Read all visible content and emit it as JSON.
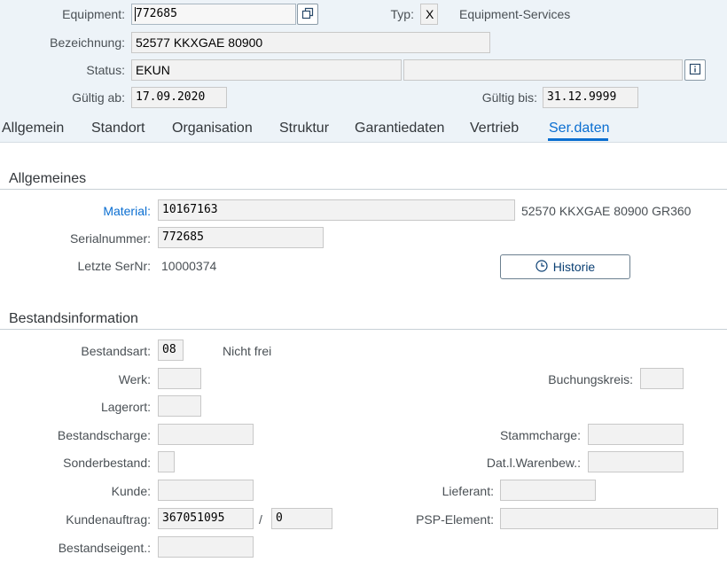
{
  "header": {
    "equipment_label": "Equipment:",
    "equipment_value": "772685",
    "typ_label": "Typ:",
    "typ_value": "X",
    "typ_text": "Equipment-Services",
    "bezeichnung_label": "Bezeichnung:",
    "bezeichnung_value": "52577 KKXGAE 80900",
    "status_label": "Status:",
    "status_value": "EKUN",
    "status_value2": "",
    "gueltig_ab_label": "Gültig ab:",
    "gueltig_ab_value": "17.09.2020",
    "gueltig_bis_label": "Gültig bis:",
    "gueltig_bis_value": "31.12.9999",
    "icons": {
      "equipment_button": "copy-window-icon",
      "status_button": "info-icon"
    }
  },
  "tabs": [
    {
      "label": "Allgemein"
    },
    {
      "label": "Standort"
    },
    {
      "label": "Organisation"
    },
    {
      "label": "Struktur"
    },
    {
      "label": "Garantiedaten"
    },
    {
      "label": "Vertrieb"
    },
    {
      "label": "Ser.daten"
    }
  ],
  "active_tab": "Ser.daten",
  "allgemeines": {
    "title": "Allgemeines",
    "material_label": "Material:",
    "material_value": "10167163",
    "material_text": "52570 KKXGAE 80900 GR360",
    "serialnummer_label": "Serialnummer:",
    "serialnummer_value": "772685",
    "letzte_sernr_label": "Letzte SerNr:",
    "letzte_sernr_value": "10000374",
    "historie_label": "Historie",
    "historie_icon": "clock-icon"
  },
  "bestand": {
    "title": "Bestandsinformation",
    "bestandsart_label": "Bestandsart:",
    "bestandsart_value": "08",
    "bestandsart_text": "Nicht frei",
    "werk_label": "Werk:",
    "werk_value": "",
    "buchungskreis_label": "Buchungskreis:",
    "buchungskreis_value": "",
    "lagerort_label": "Lagerort:",
    "lagerort_value": "",
    "bestandscharge_label": "Bestandscharge:",
    "bestandscharge_value": "",
    "stammcharge_label": "Stammcharge:",
    "stammcharge_value": "",
    "sonderbestand_label": "Sonderbestand:",
    "sonderbestand_value": "",
    "dat_warenbew_label": "Dat.l.Warenbew.:",
    "dat_warenbew_value": "",
    "kunde_label": "Kunde:",
    "kunde_value": "",
    "lieferant_label": "Lieferant:",
    "lieferant_value": "",
    "kundenauftrag_label": "Kundenauftrag:",
    "kundenauftrag_value": "367051095",
    "kundenauftrag_sep": "/",
    "kundenauftrag_pos": "0",
    "psp_label": "PSP-Element:",
    "psp_value": "",
    "bestandseigent_label": "Bestandseigent.:",
    "bestandseigent_value": ""
  }
}
